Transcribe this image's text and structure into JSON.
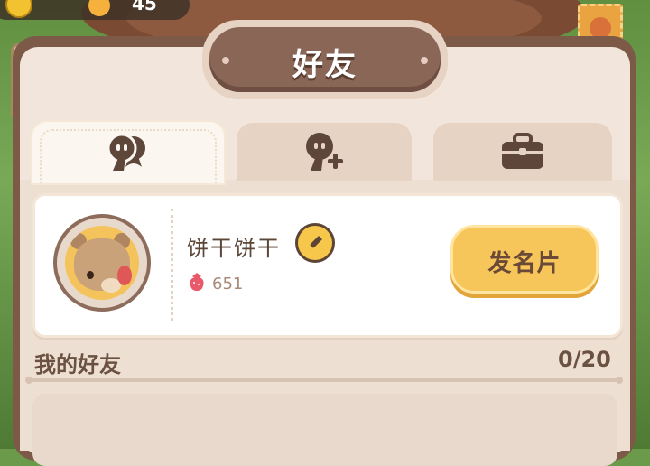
{
  "hud": {
    "count": "45"
  },
  "title": "好友",
  "tabs": [
    {
      "icon": "friends-icon",
      "active": true
    },
    {
      "icon": "add-friend-icon",
      "active": false
    },
    {
      "icon": "briefcase-icon",
      "active": false
    }
  ],
  "profile": {
    "nickname": "饼干饼干",
    "score": "651",
    "card_button": "发名片"
  },
  "friends": {
    "label": "我的好友",
    "count": "0/20"
  },
  "colors": {
    "panel_border": "#7c5a47",
    "panel_bg": "#f2e6dc",
    "accent_button": "#f7c65a",
    "title_plaque": "#8a6656"
  }
}
